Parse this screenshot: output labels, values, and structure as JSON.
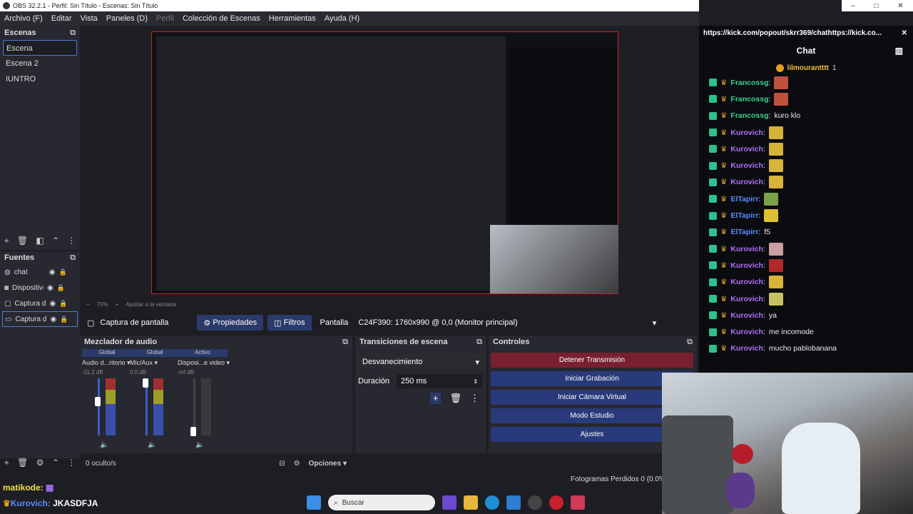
{
  "window": {
    "title": "OBS 32.2.1 - Perfil: Sin Título - Escenas: Sin Título",
    "controls": [
      "–",
      "□",
      "✕"
    ]
  },
  "menu": [
    {
      "label": "Archivo (F)",
      "dim": false
    },
    {
      "label": "Editar",
      "dim": false
    },
    {
      "label": "Vista",
      "dim": false
    },
    {
      "label": "Paneles (D)",
      "dim": false
    },
    {
      "label": "Perfil",
      "dim": true
    },
    {
      "label": "Colección de Escenas",
      "dim": false
    },
    {
      "label": "Herramientas",
      "dim": false
    },
    {
      "label": "Ayuda (H)",
      "dim": false
    }
  ],
  "scenes": {
    "title": "Escenas",
    "items": [
      "Escena",
      "Escena 2",
      "IUNTRO"
    ],
    "selected": 0
  },
  "sources": {
    "title": "Fuentes",
    "items": [
      {
        "name": "chat",
        "icon": "globe-icon"
      },
      {
        "name": "Dispositivo",
        "icon": "camera-icon"
      },
      {
        "name": "Captura d",
        "icon": "window-icon"
      },
      {
        "name": "Captura d",
        "icon": "monitor-icon"
      }
    ]
  },
  "preview": {
    "zoom": "70%",
    "fit_label": "Ajustar a la ventana"
  },
  "props": {
    "source": "Captura de pantalla",
    "properties": "Propiedades",
    "filters": "Filtros",
    "screen_label": "Pantalla",
    "screen_value": "C24F390: 1760x990 @ 0,0 (Monitor principal)"
  },
  "mixer": {
    "title": "Mezclador de audio",
    "channels": [
      {
        "mode": "Global",
        "name": "Audio d...ritorio",
        "db": "-11.2 dB",
        "muted": false
      },
      {
        "mode": "Global",
        "name": "Mic/Aux",
        "db": "0.0 dB",
        "muted": false
      },
      {
        "mode": "Activo",
        "name": "Disposi...e video",
        "db": "-inf dB",
        "muted": true
      }
    ],
    "hidden": "0 oculto/s",
    "options": "Opciones"
  },
  "transitions": {
    "title": "Transiciones de escena",
    "type": "Desvanecimiento",
    "duration_label": "Duración",
    "duration": "250 ms"
  },
  "controls": {
    "title": "Controles",
    "buttons": [
      "Detener Transmisión",
      "Iniciar Grabación",
      "Iniciar Cámara Virtual",
      "Modo Estudio",
      "Ajustes"
    ]
  },
  "status": {
    "dropped": "Fotogramas Perdidos 0 (0.0%)"
  },
  "overlay": {
    "line1_user": "matikode:",
    "line2_user": "Kurovich:",
    "line2_text": "JKASDFJA"
  },
  "taskbar": {
    "search": "Buscar"
  },
  "chat": {
    "url": "https://kick.com/popout/skrr369/chathttps://kick.co...",
    "title": "Chat",
    "pinned_user": "lilmourantttt",
    "pinned_count": "1",
    "messages": [
      {
        "user": "Francossg",
        "text": "",
        "color": "#3ecf8e",
        "emote": "#c05040"
      },
      {
        "user": "Francossg",
        "text": "",
        "color": "#3ecf8e",
        "emote": "#c05040"
      },
      {
        "user": "Francossg",
        "text": "kuro klo",
        "color": "#3ecf8e",
        "emote": ""
      },
      {
        "user": "Kurovich",
        "text": "",
        "color": "#b070ff",
        "emote": "#d9b23a"
      },
      {
        "user": "Kurovich",
        "text": "",
        "color": "#b070ff",
        "emote": "#d9b23a"
      },
      {
        "user": "Kurovich",
        "text": "",
        "color": "#b070ff",
        "emote": "#d9b23a"
      },
      {
        "user": "Kurovich",
        "text": "",
        "color": "#b070ff",
        "emote": "#d9b23a"
      },
      {
        "user": "ElTapirr",
        "text": "",
        "color": "#5a8bff",
        "emote": "#7aa04a"
      },
      {
        "user": "ElTapirr",
        "text": "",
        "color": "#5a8bff",
        "emote": "#e0c030"
      },
      {
        "user": "ElTapirr",
        "text": "f5",
        "color": "#5a8bff",
        "emote": ""
      },
      {
        "user": "Kurovich",
        "text": "",
        "color": "#b070ff",
        "emote": "#c9a0a0"
      },
      {
        "user": "Kurovich",
        "text": "",
        "color": "#b070ff",
        "emote": "#b02a2a"
      },
      {
        "user": "Kurovich",
        "text": "",
        "color": "#b070ff",
        "emote": "#d9b23a"
      },
      {
        "user": "Kurovich",
        "text": "",
        "color": "#b070ff",
        "emote": "#c8c060"
      },
      {
        "user": "Kurovich",
        "text": "ya",
        "color": "#b070ff",
        "emote": ""
      },
      {
        "user": "Kurovich",
        "text": "me incomode",
        "color": "#b070ff",
        "emote": ""
      },
      {
        "user": "Kurovich",
        "text": "mucho pablobanana",
        "color": "#b070ff",
        "emote": ""
      }
    ]
  }
}
